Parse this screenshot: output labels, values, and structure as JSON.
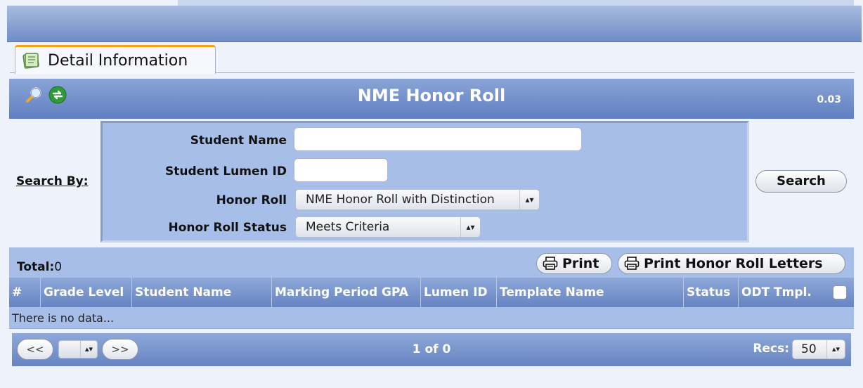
{
  "tab": {
    "label": "Detail Information"
  },
  "panel": {
    "title": "NME Honor Roll",
    "version": "0.03"
  },
  "search": {
    "search_by_label": "Search By:",
    "student_name_label": "Student Name",
    "student_name_value": "",
    "lumen_id_label": "Student Lumen ID",
    "lumen_id_value": "",
    "honor_roll_label": "Honor Roll",
    "honor_roll_selected": "NME Honor Roll with Distinction",
    "status_label": "Honor Roll Status",
    "status_selected": "Meets Criteria",
    "search_button": "Search"
  },
  "results": {
    "total_label": "Total:",
    "total_value": "0",
    "print_button": "Print",
    "print_letters_button": "Print Honor Roll Letters",
    "columns": [
      "#",
      "Grade Level",
      "Student Name",
      "Marking Period GPA",
      "Lumen ID",
      "Template Name",
      "Status",
      "ODT Tmpl."
    ],
    "empty_message": "There is no data..."
  },
  "pager": {
    "prev_label": "<<",
    "next_label": ">>",
    "page_info": "1 of 0",
    "recs_label": "Recs:",
    "recs_value": "50"
  },
  "icons": {
    "tab": "notepad-icon",
    "search": "magnifier-icon",
    "refresh": "refresh-icon",
    "print": "printer-icon"
  },
  "colors": {
    "header_blue": "#6f8dc6",
    "panel_light": "#a7bfe8",
    "tab_accent": "#f3a21a"
  }
}
